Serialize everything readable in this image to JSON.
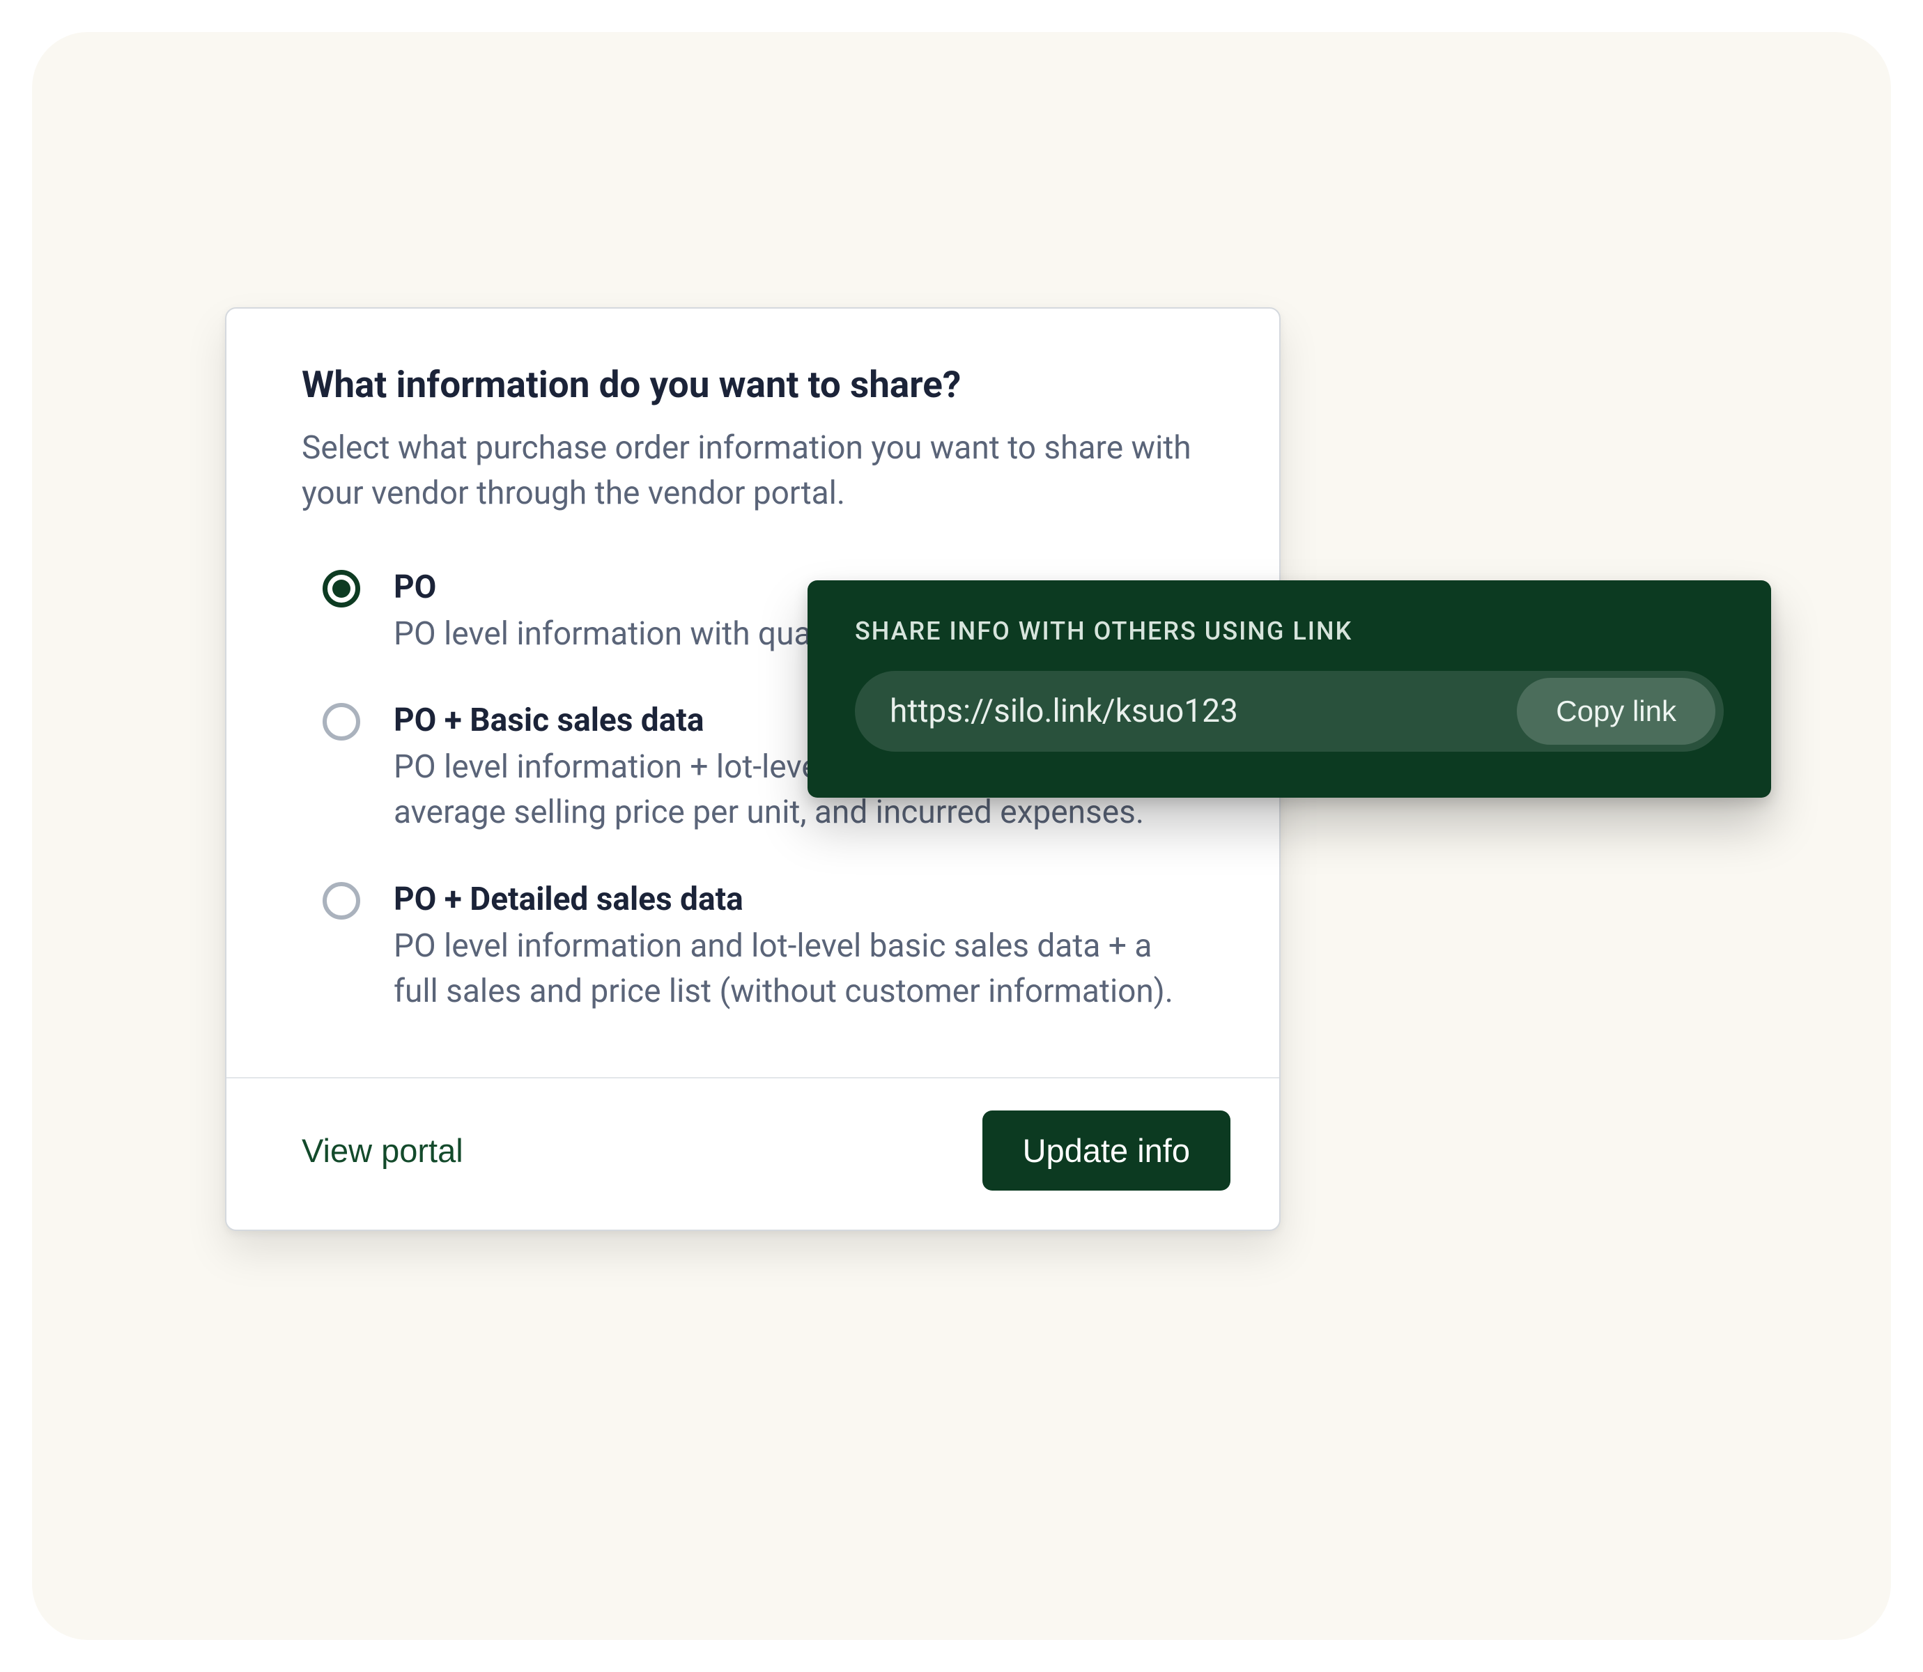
{
  "card": {
    "title": "What information do you want to share?",
    "subtitle": "Select what purchase order information you want to share with your vendor through the vendor portal.",
    "options": [
      {
        "label": "PO",
        "description": "PO level information with quantity, price, and total.",
        "selected": true
      },
      {
        "label": "PO + Basic sales data",
        "description": "PO level information + lot-level total sales, break even, average selling price per unit, and incurred expenses.",
        "selected": false
      },
      {
        "label": "PO + Detailed sales data",
        "description": "PO level information and lot-level basic sales data + a full sales and price list (without customer information).",
        "selected": false
      }
    ],
    "footer": {
      "view_portal": "View portal",
      "update_info": "Update info"
    }
  },
  "popover": {
    "label": "SHARE INFO WITH OTHERS USING LINK",
    "url": "https://silo.link/ksuo123",
    "copy_label": "Copy link"
  },
  "colors": {
    "accent_dark_green": "#0c3a21",
    "page_cream": "#faf8f2",
    "text_dark": "#1b2338",
    "text_muted": "#5a6478"
  }
}
